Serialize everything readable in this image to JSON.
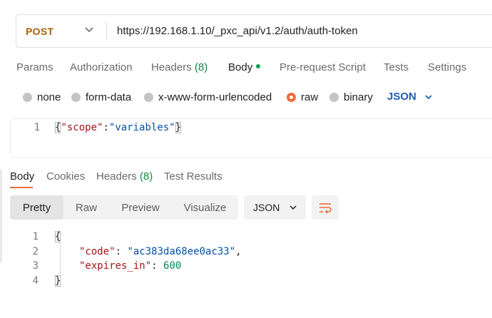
{
  "request": {
    "method": "POST",
    "url": "https://192.168.1.10/_pxc_api/v1.2/auth/auth-token",
    "tabs": {
      "params": "Params",
      "authorization": "Authorization",
      "headers_label": "Headers",
      "headers_count": "(8)",
      "body": "Body",
      "prerequest": "Pre-request Script",
      "tests": "Tests",
      "settings": "Settings"
    },
    "body_types": {
      "none": "none",
      "form_data": "form-data",
      "urlencoded": "x-www-form-urlencoded",
      "raw": "raw",
      "binary": "binary",
      "selected": "raw"
    },
    "language": "JSON",
    "editor": {
      "line_numbers": [
        "1"
      ],
      "open_brace": "{",
      "key": "\"scope\"",
      "colon": ":",
      "value": "\"variables\"",
      "close_brace": "}"
    }
  },
  "response": {
    "tabs": {
      "body": "Body",
      "cookies": "Cookies",
      "headers_label": "Headers",
      "headers_count": "(8)",
      "test_results": "Test Results"
    },
    "views": {
      "pretty": "Pretty",
      "raw": "Raw",
      "preview": "Preview",
      "visualize": "Visualize",
      "selected": "Pretty"
    },
    "format": "JSON",
    "line_numbers": [
      "1",
      "2",
      "3",
      "4"
    ],
    "lines": {
      "open_brace": "{",
      "code_key": "\"code\"",
      "code_value": "\"ac383da68ee0ac33\"",
      "expires_key": "\"expires_in\"",
      "expires_value": "600",
      "close_brace": "}"
    }
  },
  "icons": {
    "method_dropdown": "chevron-down-icon",
    "language_dropdown": "chevron-down-icon",
    "format_dropdown": "chevron-down-icon",
    "wrap": "wrap-lines-icon"
  },
  "colors": {
    "accent": "#ef6c3b",
    "method": "#a8620a",
    "link_blue": "#1a5fb4",
    "count_green": "#0f8a3c",
    "json_key": "#a31515",
    "json_string": "#0451a5",
    "json_number": "#098658"
  }
}
